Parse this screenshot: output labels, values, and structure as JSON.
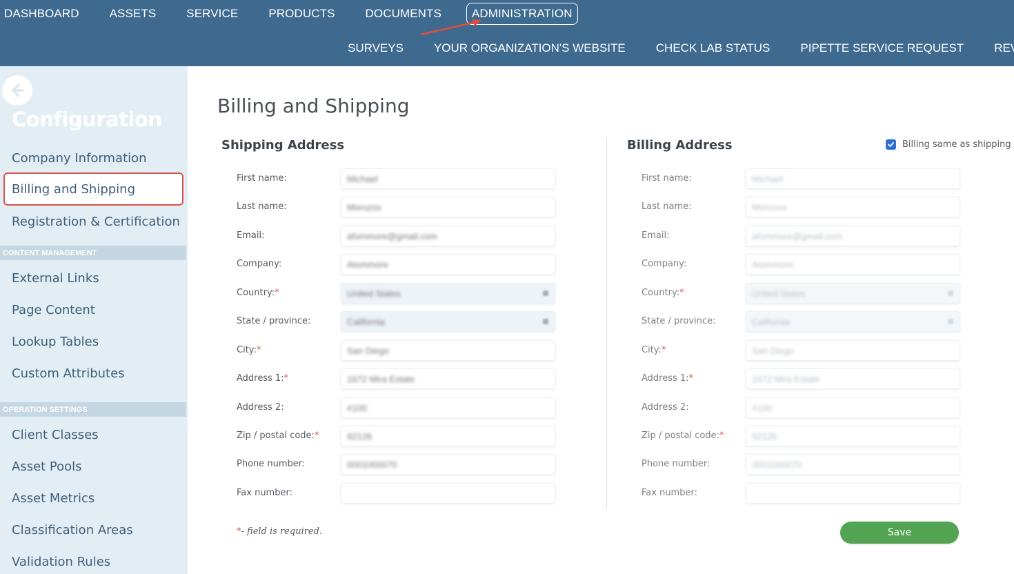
{
  "colors": {
    "nav_bg": "#3f6a8f",
    "sidebar_bg": "#e2eef4",
    "highlight_red": "#d9534f",
    "save_green": "#52a352",
    "checkbox_blue": "#2f6fd1"
  },
  "top_nav": {
    "primary": [
      "DASHBOARD",
      "ASSETS",
      "SERVICE",
      "PRODUCTS",
      "DOCUMENTS",
      "ADMINISTRATION"
    ],
    "active": "ADMINISTRATION",
    "secondary": [
      "SURVEYS",
      "YOUR ORGANIZATION'S WEBSITE",
      "CHECK LAB STATUS",
      "PIPETTE SERVICE REQUEST",
      "REVIEW"
    ]
  },
  "sidebar": {
    "back_icon": "arrow-left-icon",
    "title": "Configuration",
    "items": [
      {
        "label": "Company Information"
      },
      {
        "label": "Billing and Shipping",
        "active": true
      },
      {
        "label": "Registration & Certification"
      }
    ],
    "section_content": "CONTENT MANAGEMENT",
    "content_items": [
      {
        "label": "External Links"
      },
      {
        "label": "Page Content"
      },
      {
        "label": "Lookup Tables"
      },
      {
        "label": "Custom Attributes"
      }
    ],
    "section_operation": "OPERATION SETTINGS",
    "operation_items": [
      {
        "label": "Client Classes"
      },
      {
        "label": "Asset Pools"
      },
      {
        "label": "Asset Metrics"
      },
      {
        "label": "Classification Areas"
      },
      {
        "label": "Validation Rules"
      }
    ]
  },
  "main": {
    "title": "Billing and Shipping",
    "shipping_heading": "Shipping Address",
    "billing_heading": "Billing Address",
    "billing_same_label": "Billing same as shipping",
    "billing_same_checked": true,
    "labels": {
      "first_name": "First name:",
      "last_name": "Last name:",
      "email": "Email:",
      "company": "Company:",
      "country": "Country:",
      "state": "State / province:",
      "city": "City:",
      "address1": "Address 1:",
      "address2": "Address 2:",
      "zip": "Zip / postal code:",
      "phone": "Phone number:",
      "fax": "Fax number:"
    },
    "required_star": "*",
    "values": {
      "first_name": "Michael",
      "last_name": "Morozov",
      "email": "afommore@gmail.com",
      "company": "Atommore",
      "country": "United States",
      "state": "California",
      "city": "San Diego",
      "address1": "1672 Mira Estate",
      "address2": "#100",
      "zip": "92126",
      "phone": "0001000070",
      "fax": ""
    },
    "required_note_star": "*",
    "required_note": "- field is required.",
    "save_label": "Save"
  }
}
